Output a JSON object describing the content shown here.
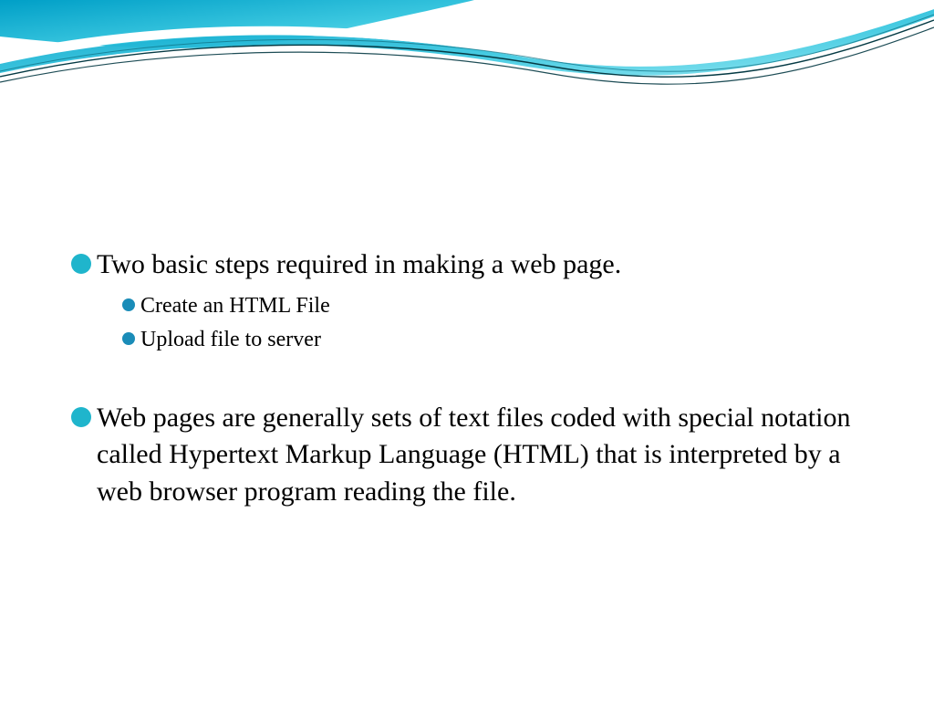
{
  "slide": {
    "bullets": [
      {
        "text": "Two basic steps required in making a web page.",
        "subitems": [
          "Create an HTML File",
          "Upload file to server"
        ]
      },
      {
        "text": "Web pages are generally sets of text files coded with special notation called Hypertext Markup Language (HTML) that is interpreted by a web browser program reading the file.",
        "subitems": []
      }
    ],
    "theme": {
      "accent": "#1fb5cc",
      "accent_dark": "#1a8cb8",
      "wave_gradient_start": "#009fc7",
      "wave_gradient_end": "#55d4e8"
    }
  }
}
